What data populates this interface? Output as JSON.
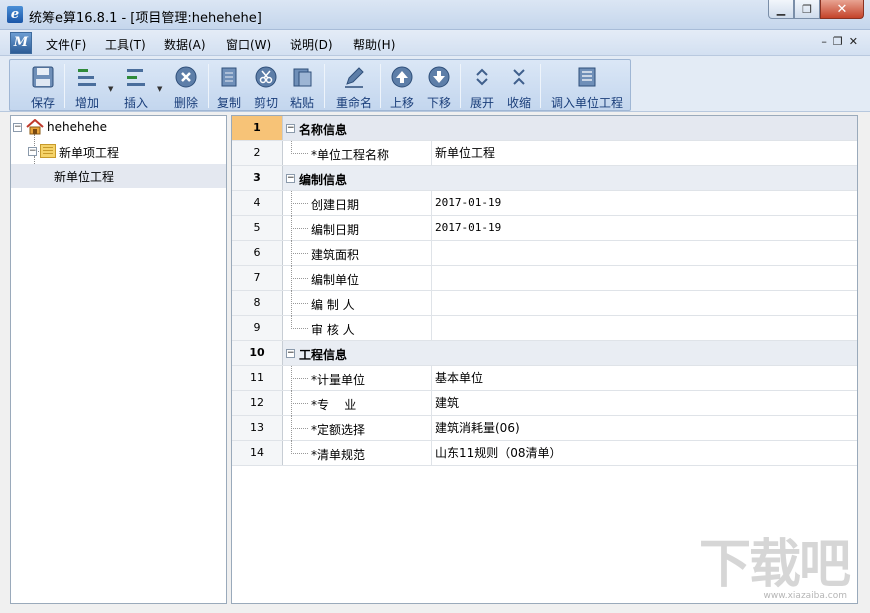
{
  "window": {
    "title": "统筹e算16.8.1 - [项目管理:hehehehe]",
    "app_icon_glyph": "e",
    "buttons": {
      "minimize": "▁",
      "restore": "❐",
      "close": "✕"
    }
  },
  "menubar": {
    "logo_glyph": "M",
    "items": [
      "文件(F)",
      "工具(T)",
      "数据(A)",
      "窗口(W)",
      "说明(D)",
      "帮助(H)"
    ],
    "mdi_buttons": [
      "–",
      "❐",
      "✕"
    ]
  },
  "toolbar": {
    "buttons": [
      {
        "label": "保存",
        "icon": "save-icon"
      },
      {
        "label": "增加",
        "icon": "add-icon"
      },
      {
        "label": "插入",
        "icon": "insert-icon"
      },
      {
        "label": "删除",
        "icon": "delete-icon"
      },
      {
        "label": "复制",
        "icon": "copy-icon"
      },
      {
        "label": "剪切",
        "icon": "cut-icon"
      },
      {
        "label": "粘贴",
        "icon": "paste-icon"
      },
      {
        "label": "重命名",
        "icon": "rename-icon"
      },
      {
        "label": "上移",
        "icon": "move-up-icon"
      },
      {
        "label": "下移",
        "icon": "move-down-icon"
      },
      {
        "label": "展开",
        "icon": "expand-icon"
      },
      {
        "label": "收缩",
        "icon": "collapse-icon"
      },
      {
        "label": "调入单位工程",
        "icon": "import-unit-icon"
      }
    ]
  },
  "tree": {
    "root": "hehehehe",
    "child": "新单项工程",
    "leaf": "新单位工程"
  },
  "grid": {
    "rows": [
      {
        "num": "1",
        "type": "category",
        "label": "名称信息",
        "value": ""
      },
      {
        "num": "2",
        "type": "item",
        "label": "*单位工程名称",
        "value": "新单位工程"
      },
      {
        "num": "3",
        "type": "category",
        "label": "编制信息",
        "value": ""
      },
      {
        "num": "4",
        "type": "item",
        "label": "创建日期",
        "value": "2017-01-19"
      },
      {
        "num": "5",
        "type": "item",
        "label": "编制日期",
        "value": "2017-01-19"
      },
      {
        "num": "6",
        "type": "item",
        "label": "建筑面积",
        "value": ""
      },
      {
        "num": "7",
        "type": "item",
        "label": "编制单位",
        "value": ""
      },
      {
        "num": "8",
        "type": "item",
        "label": "编 制 人",
        "value": ""
      },
      {
        "num": "9",
        "type": "item",
        "label": "审 核 人",
        "value": ""
      },
      {
        "num": "10",
        "type": "category",
        "label": "工程信息",
        "value": ""
      },
      {
        "num": "11",
        "type": "item",
        "label": "*计量单位",
        "value": "基本单位"
      },
      {
        "num": "12",
        "type": "item",
        "label": "*专    业",
        "value": "建筑"
      },
      {
        "num": "13",
        "type": "item",
        "label": "*定额选择",
        "value": "建筑消耗量(06)"
      },
      {
        "num": "14",
        "type": "item",
        "label": "*清单规范",
        "value": "山东11规则（08清单）"
      }
    ]
  },
  "watermark": {
    "text": "下载吧",
    "url": "www.xiazaiba.com"
  },
  "colors": {
    "accent": "#1a3e7a",
    "active_row": "#f7c377",
    "toolbar_bg": "#c3d6ee"
  }
}
